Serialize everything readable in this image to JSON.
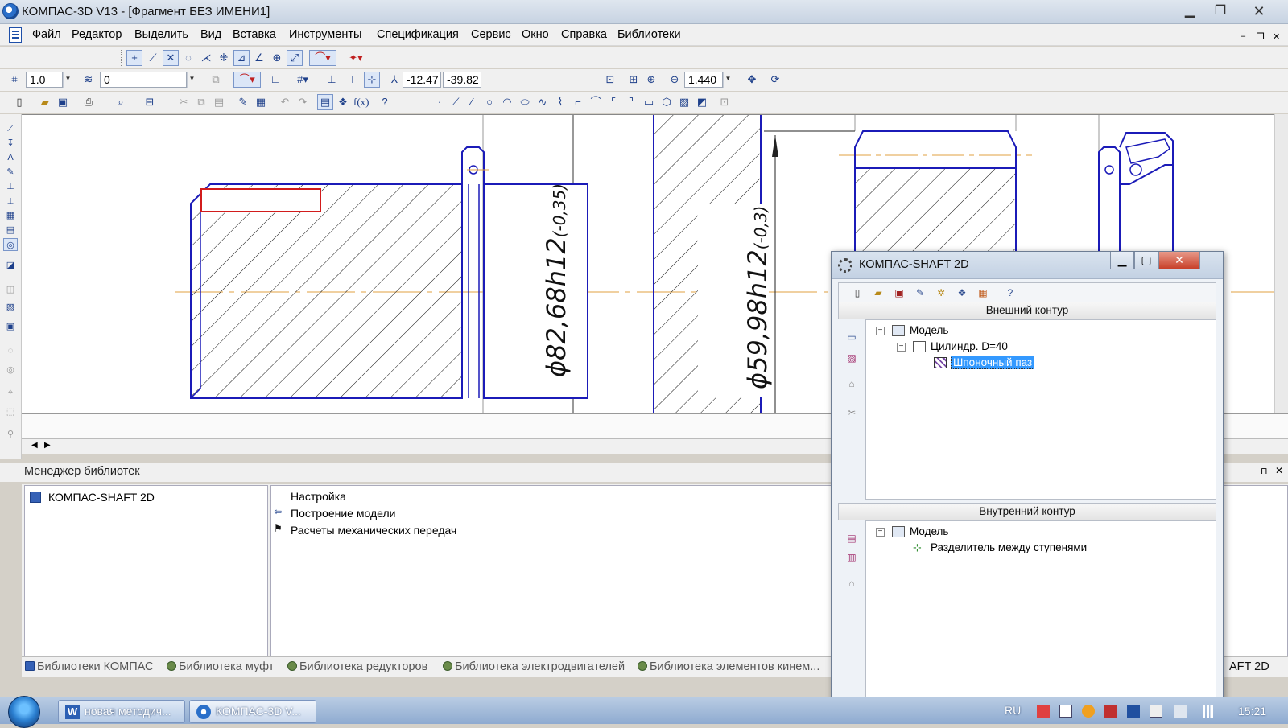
{
  "window": {
    "title": "КОМПАС-3D V13 - [Фрагмент БЕЗ ИМЕНИ1]",
    "minimize": "▁",
    "maximize": "❐",
    "close": "✕"
  },
  "menu": {
    "items": [
      "Файл",
      "Редактор",
      "Выделить",
      "Вид",
      "Вставка",
      "Инструменты",
      "Спецификация",
      "Сервис",
      "Окно",
      "Справка",
      "Библиотеки"
    ],
    "mdi_buttons": [
      "‒",
      "❐",
      "✕"
    ]
  },
  "toolbar_current": {
    "step": "1.0",
    "layer": "0",
    "coord_x": "-12.47",
    "coord_y": "-39.82",
    "zoom": "1.440"
  },
  "drawing": {
    "dim1": "ϕ82,68h12",
    "dim1_tol": "(-0,35)",
    "dim2": "ϕ59,98h12",
    "dim2_tol": "(-0,3)"
  },
  "library_manager": {
    "title": "Менеджер библиотек",
    "tree": [
      "КОМПАС-SHAFT 2D"
    ],
    "list": [
      "Настройка",
      "Построение модели",
      "Расчеты механических передач"
    ],
    "tabs": [
      "Библиотеки КОМПАС",
      "Библиотека муфт",
      "Библиотека редукторов",
      "Библиотека электродвигателей",
      "Библиотека элементов кинем..."
    ],
    "tab_right": "AFT 2D",
    "pin": "⊓",
    "close": "✕"
  },
  "dialog": {
    "title": "КОМПАС-SHAFT 2D",
    "outer_section": "Внешний контур",
    "inner_section": "Внутренний контур",
    "outer_tree": {
      "root": "Модель",
      "child": "Цилиндр. D=40",
      "grandchild": "Шпоночный паз"
    },
    "inner_tree": {
      "root": "Модель",
      "child": "Разделитель между ступенями"
    },
    "buttons": {
      "minimize": "▁",
      "maximize": "▢",
      "close": "✕"
    }
  },
  "taskbar": {
    "tasks": [
      "новая методич...",
      "КОМПАС-3D V..."
    ],
    "lang": "RU",
    "time": "15:21"
  },
  "colors": {
    "line": "#1b1bb8",
    "axis": "#e0a040",
    "highlight": "#d21c1c",
    "selection": "#3399ff"
  }
}
